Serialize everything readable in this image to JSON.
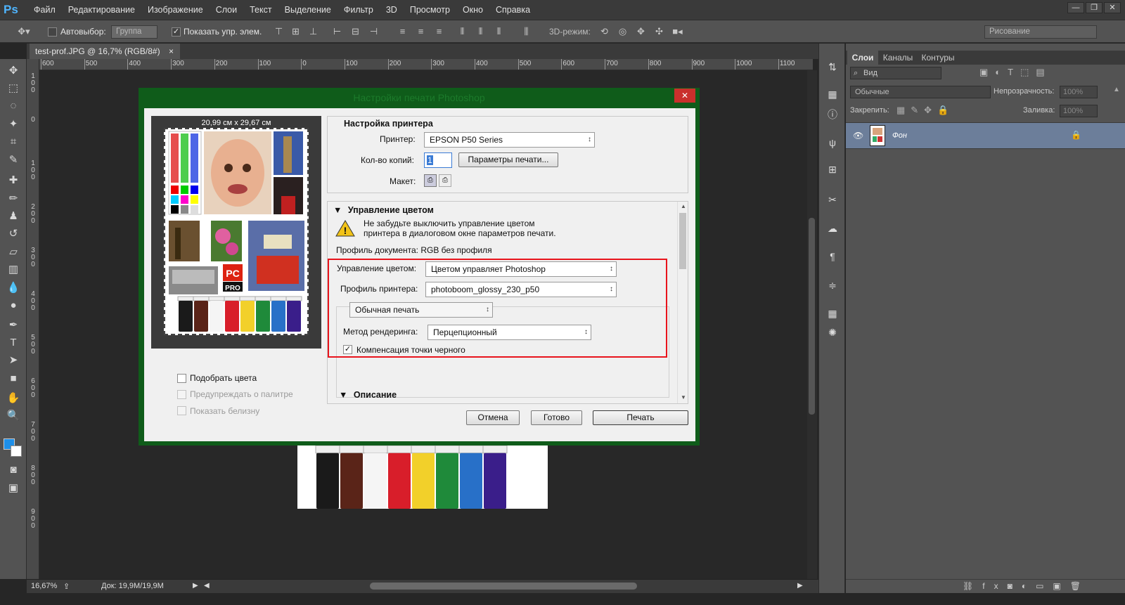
{
  "app": {
    "logo": "Ps"
  },
  "menu": [
    "Файл",
    "Редактирование",
    "Изображение",
    "Слои",
    "Текст",
    "Выделение",
    "Фильтр",
    "3D",
    "Просмотр",
    "Окно",
    "Справка"
  ],
  "window_controls": {
    "minimize": "—",
    "restore": "❐",
    "close": "✕"
  },
  "options_bar": {
    "autoselect_label": "Автовыбор:",
    "autoselect_value": "Группа",
    "show_controls_label": "Показать упр. элем.",
    "mode3d_label": "3D-режим:",
    "workspace": "Рисование"
  },
  "document": {
    "tab_title": "test-prof.JPG @ 16,7% (RGB/8#)",
    "close": "×"
  },
  "ruler": {
    "h_ticks": [
      "600",
      "500",
      "400",
      "300",
      "200",
      "100",
      "0",
      "100",
      "200",
      "300",
      "400",
      "500",
      "600",
      "700",
      "800",
      "900",
      "1000",
      "1100"
    ],
    "v_ticks": [
      "1\n0\n0",
      "0",
      "1\n0\n0",
      "2\n0\n0",
      "3\n0\n0",
      "4\n0\n0",
      "5\n0\n0",
      "6\n0\n0",
      "7\n0\n0",
      "8\n0\n0",
      "9\n0\n0"
    ]
  },
  "status": {
    "zoom": "16,67%",
    "doc_info": "Док: 19,9M/19,9M"
  },
  "layers_panel": {
    "tabs": [
      "Слои",
      "Каналы",
      "Контуры"
    ],
    "filter_value": "Вид",
    "blend_mode": "Обычные",
    "opacity_label": "Непрозрачность:",
    "opacity_value": "100%",
    "lock_label": "Закрепить:",
    "fill_label": "Заливка:",
    "fill_value": "100%",
    "layer_name": "Фон"
  },
  "print_dialog": {
    "title": "Настройки печати Photoshop",
    "close": "✕",
    "preview_size": "20,99 см x 29,67 см",
    "pc_logo_top": "PC",
    "pc_logo_bottom": "PRO",
    "match_colors": "Подобрать цвета",
    "gamut_warning": "Предупреждать о палитре",
    "show_white": "Показать белизну",
    "printer_setup_title": "Настройка принтера",
    "printer_label": "Принтер:",
    "printer_value": "EPSON P50 Series",
    "copies_label": "Кол-во копий:",
    "copies_value": "1",
    "print_settings_button": "Параметры печати...",
    "layout_label": "Макет:",
    "color_mgmt_title": "Управление цветом",
    "warning_text_1": "Не забудьте выключить управление цветом",
    "warning_text_2": "принтера в диалоговом окне параметров печати.",
    "doc_profile": "Профиль документа: RGB без профиля",
    "color_handling_label": "Управление цветом:",
    "color_handling_value": "Цветом управляет Photoshop",
    "printer_profile_label": "Профиль принтера:",
    "printer_profile_value": "photoboom_glossy_230_p50",
    "print_mode_value": "Обычная печать",
    "rendering_label": "Метод рендеринга:",
    "rendering_value": "Перцепционный",
    "black_point_label": "Компенсация точки черного",
    "description_title": "Описание",
    "cancel_button": "Отмена",
    "done_button": "Готово",
    "print_button": "Печать"
  },
  "colors": {
    "highlight_box": "#e8141c",
    "dialog_frame": "#0f5c1a",
    "accent_blue": "#2a8ae6"
  }
}
